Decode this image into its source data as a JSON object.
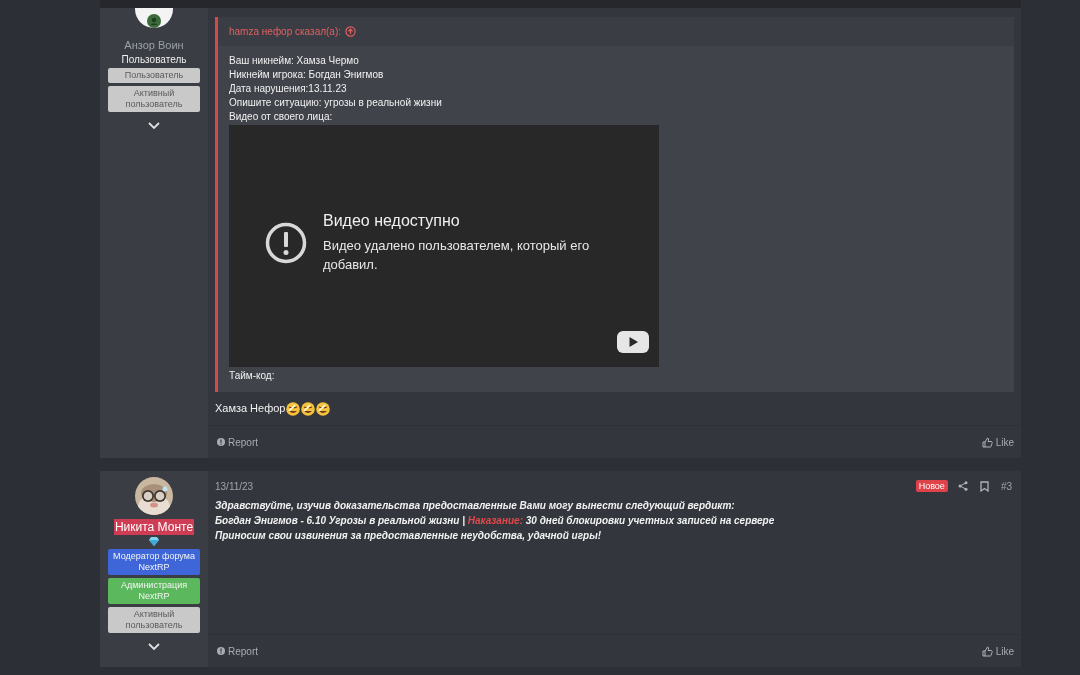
{
  "posts": [
    {
      "author": {
        "avatar": {
          "kind": "blank"
        },
        "online": true,
        "name": "Анзор Воин",
        "name_highlight": false,
        "gem": false,
        "title": "Пользователь",
        "banners": [
          {
            "text": "Пользователь",
            "color": "#c9c9c9"
          },
          {
            "text": "Активный пользователь",
            "color": "#c9c9c9"
          }
        ]
      },
      "quote": {
        "author": "hamza нефор сказал(а):",
        "lines": [
          "Ваш никнейм: Хамза Чермо",
          "Никнейм игрока: Богдан Энигмов",
          "Дата нарушения:13.11.23",
          "Опишите ситуацию: угрозы в реальной жизни",
          "Видео от своего лица:"
        ],
        "video": {
          "title": "Видео недоступно",
          "message": "Видео удалено пользователем, который его добавил."
        },
        "after": "Тайм-код:"
      },
      "message": [
        [
          {
            "text": "Хамза Нефор",
            "kind": "plain"
          }
        ]
      ],
      "italic": false,
      "report": "Report",
      "like": "Like"
    },
    {
      "author": {
        "online": false,
        "name": "Никита Монте",
        "name_highlight": true,
        "gem": true,
        "banners": [
          {
            "text": "Модератор форума NextRP",
            "color": "#3f66d9"
          },
          {
            "text": "Администрация NextRP",
            "color": "#5cb85c"
          },
          {
            "text": "Активный пользователь",
            "color": "#c9c9c9"
          }
        ]
      },
      "date": "13/11/23",
      "badge": "Новое",
      "number": "#3",
      "message": [
        [
          {
            "text": "Здравствуйте, изучив доказательства предоставленные Вами могу вынести следующий вердикт:",
            "kind": "plain"
          }
        ],
        [
          {
            "text": "Богдан Энигмов - 6.10 Угрозы в реальной жизни | ",
            "kind": "plain"
          },
          {
            "text": "Наказание:",
            "kind": "highlight"
          },
          {
            "text": " 30 дней блокировки учетных записей на сервере",
            "kind": "plain"
          }
        ],
        [
          {
            "text": "Приносим свои извинения за предоставленные неудобства, удачной игры!",
            "kind": "plain"
          }
        ]
      ],
      "italic": true,
      "report": "Report",
      "like": "Like"
    }
  ]
}
